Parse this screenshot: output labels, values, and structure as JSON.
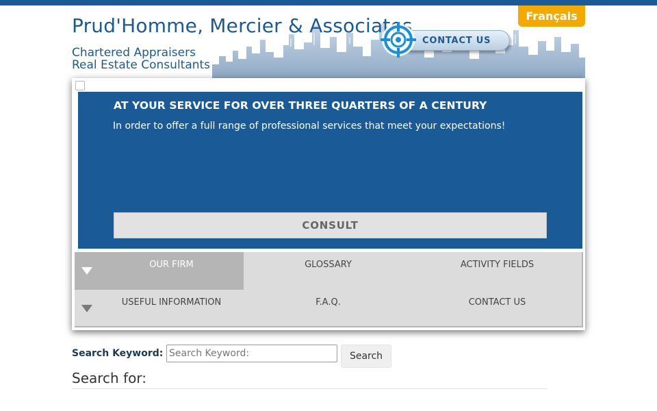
{
  "header": {
    "title": "Prud'Homme, Mercier & Associates",
    "subtitle_line1": "Chartered Appraisers",
    "subtitle_line2": "Real Estate Consultants",
    "language_button": "Français",
    "contact_button": "CONTACT US"
  },
  "hero": {
    "title": "AT YOUR SERVICE FOR OVER THREE QUARTERS OF A CENTURY",
    "text": "In order to offer a full range of professional services that meet your expectations!",
    "button": "CONSULT"
  },
  "menu": {
    "row1": [
      "OUR FIRM",
      "GLOSSARY",
      "ACTIVITY FIELDS"
    ],
    "row2": [
      "USEFUL INFORMATION",
      "F.A.Q.",
      "CONTACT US"
    ],
    "active": "OUR FIRM"
  },
  "search": {
    "label": "Search Keyword:",
    "placeholder": "Search Keyword:",
    "value": "",
    "button": "Search",
    "results_heading": "Search for:"
  },
  "icons": {
    "contact": "target-icon",
    "menu_expand": "triangle-down-icon"
  },
  "colors": {
    "brand_blue": "#1a5a96",
    "accent_orange": "#f2a900",
    "menu_bg": "#dcdcdc",
    "menu_active": "#b5b5b5"
  }
}
